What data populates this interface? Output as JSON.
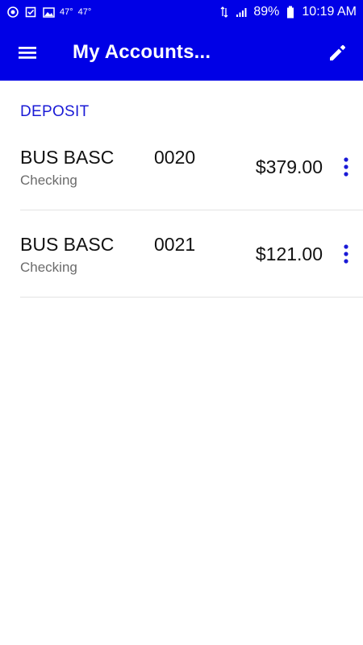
{
  "status_bar": {
    "temp1": "47°",
    "temp2": "47°",
    "battery": "89%",
    "time": "10:19 AM"
  },
  "app_bar": {
    "title": "My Accounts..."
  },
  "section": {
    "label": "DEPOSIT"
  },
  "accounts": [
    {
      "name": "BUS BASC",
      "type": "Checking",
      "number": "0020",
      "balance": "$379.00"
    },
    {
      "name": "BUS BASC",
      "type": "Checking",
      "number": "0021",
      "balance": "$121.00"
    }
  ],
  "colors": {
    "primary": "#0000e6",
    "section_label": "#1a1ad6",
    "kebab": "#1a1ad6",
    "secondary_text": "#6b6b6b",
    "divider": "#e3e3e3"
  },
  "icons": {
    "menu": "hamburger-menu-icon",
    "edit": "pencil-icon",
    "row_menu": "more-vertical-icon"
  }
}
